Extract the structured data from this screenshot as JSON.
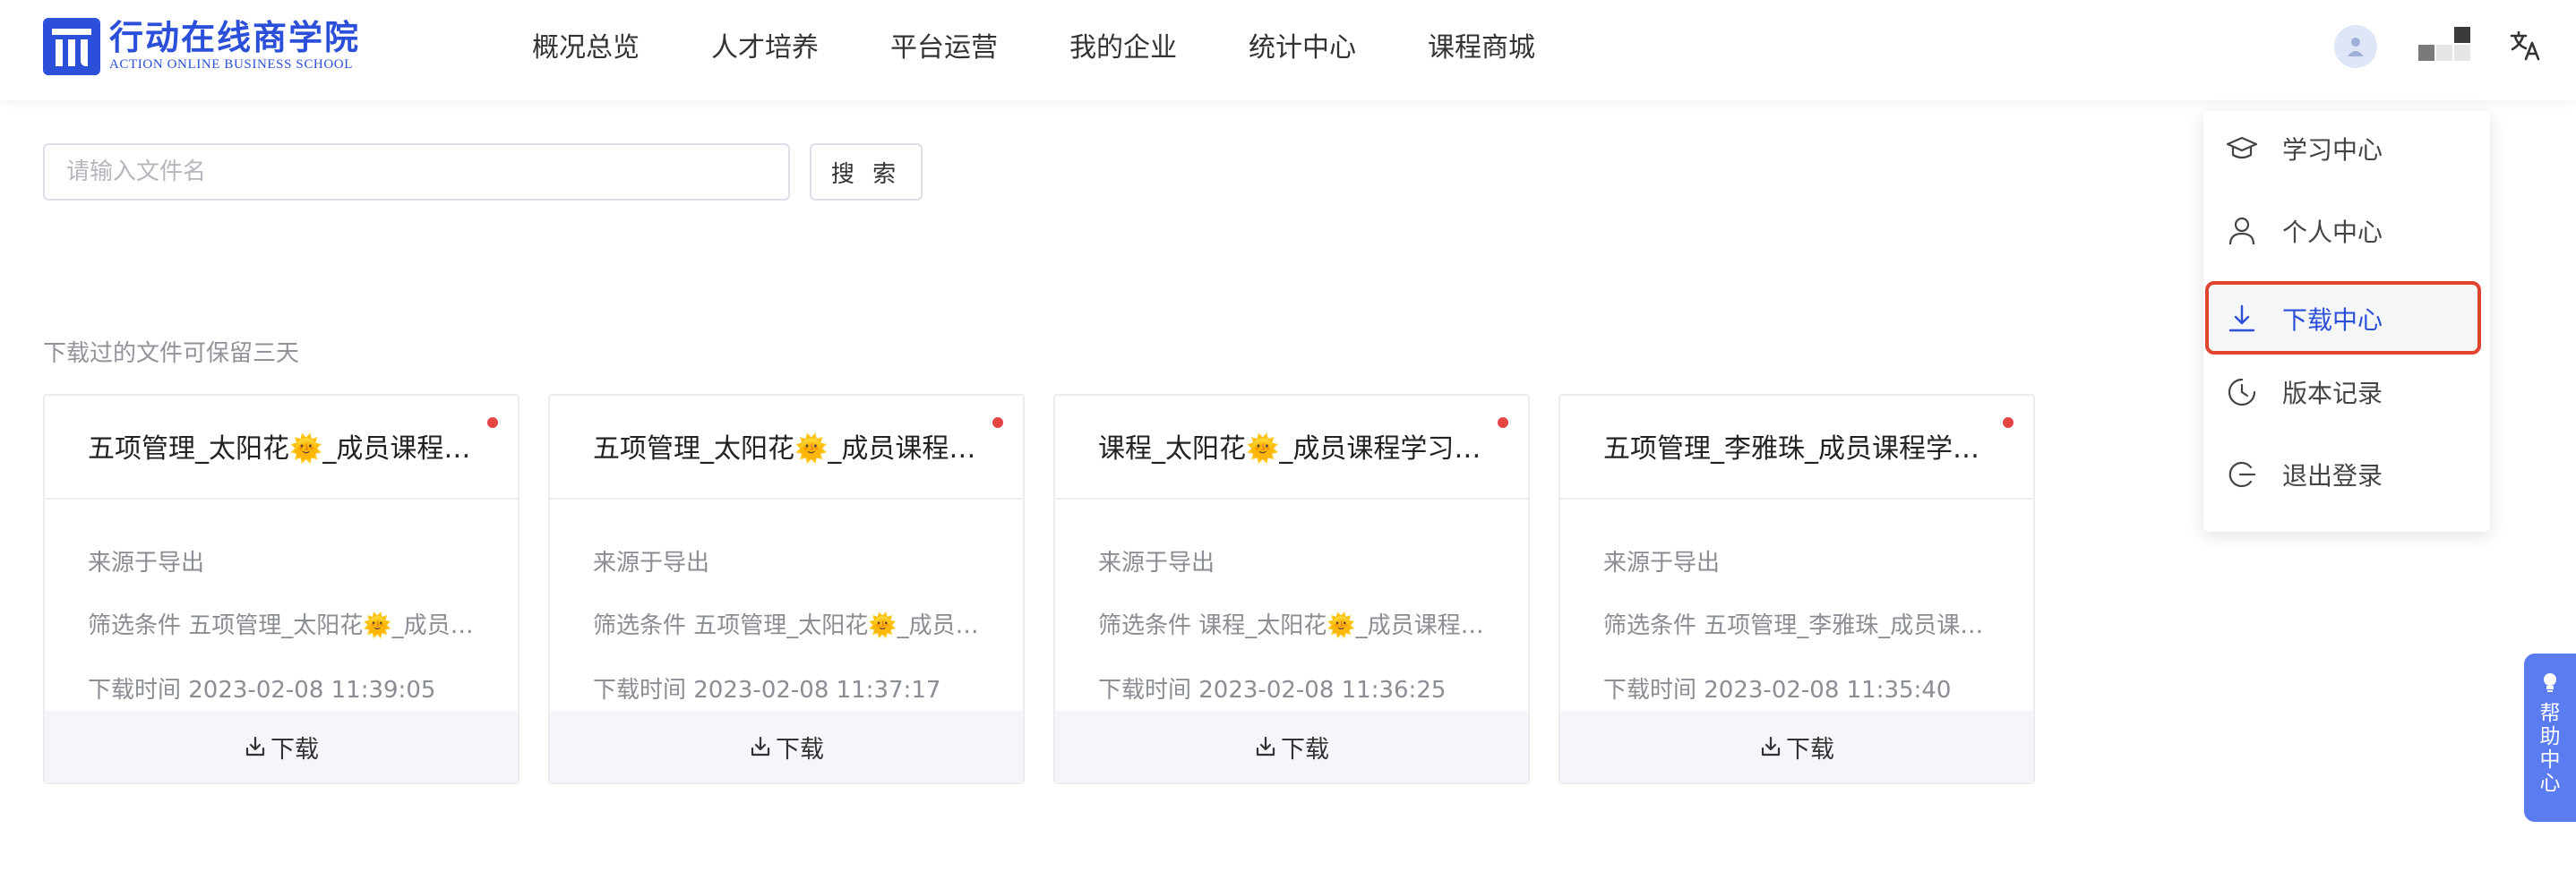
{
  "header": {
    "logo_cn": "行动在线商学院",
    "logo_en": "ACTION ONLINE BUSINESS SCHOOL",
    "nav": [
      "概况总览",
      "人才培养",
      "平台运营",
      "我的企业",
      "统计中心",
      "课程商城"
    ]
  },
  "search": {
    "placeholder": "请输入文件名",
    "button_label": "搜 索"
  },
  "note": "下载过的文件可保留三天",
  "cards": [
    {
      "title": "五项管理_太阳花🌞_成员课程学习明细",
      "source": "来源于导出",
      "filter": "筛选条件 五项管理_太阳花🌞_成员课程",
      "time": "下载时间 2023-02-08 11:39:05",
      "download_label": "下载"
    },
    {
      "title": "五项管理_太阳花🌞_成员课程学习明细",
      "source": "来源于导出",
      "filter": "筛选条件 五项管理_太阳花🌞_成员课程",
      "time": "下载时间 2023-02-08 11:37:17",
      "download_label": "下载"
    },
    {
      "title": "课程_太阳花🌞_成员课程学习明细",
      "source": "来源于导出",
      "filter": "筛选条件 课程_太阳花🌞_成员课程学习",
      "time": "下载时间 2023-02-08 11:36:25",
      "download_label": "下载"
    },
    {
      "title": "五项管理_李雅珠_成员课程学习明细",
      "source": "来源于导出",
      "filter": "筛选条件 五项管理_李雅珠_成员课程学习",
      "time": "下载时间 2023-02-08 11:35:40",
      "download_label": "下载"
    }
  ],
  "dropdown": [
    {
      "label": "学习中心",
      "icon": "graduation-cap-icon"
    },
    {
      "label": "个人中心",
      "icon": "user-icon"
    },
    {
      "label": "下载中心",
      "icon": "download-icon",
      "active": true
    },
    {
      "label": "版本记录",
      "icon": "history-icon"
    },
    {
      "label": "退出登录",
      "icon": "logout-icon"
    }
  ],
  "help": {
    "label": "帮助中心"
  },
  "colors": {
    "brand": "#2b4fd8",
    "dot": "#e54545",
    "highlight": "#e0432e",
    "help_tab": "#5b7cf0"
  }
}
